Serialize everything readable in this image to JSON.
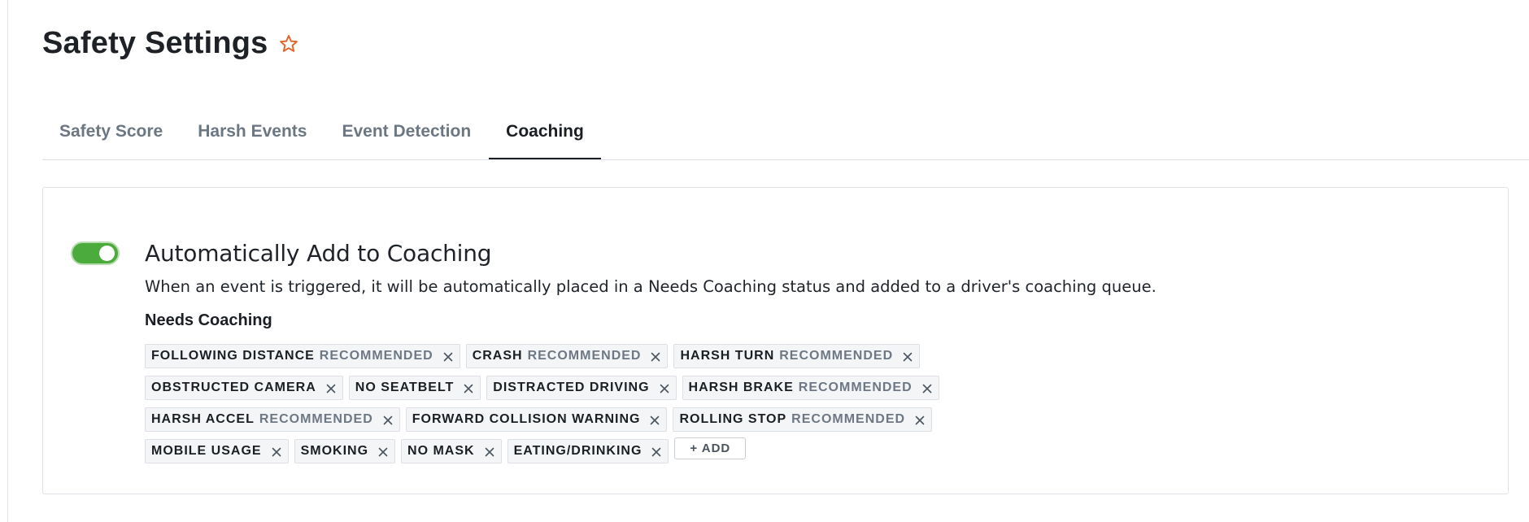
{
  "page": {
    "title": "Safety Settings",
    "favorite_icon": "star-outline-icon",
    "accent": "#e0662b"
  },
  "tabs": [
    {
      "label": "Safety Score",
      "active": false
    },
    {
      "label": "Harsh Events",
      "active": false
    },
    {
      "label": "Event Detection",
      "active": false
    },
    {
      "label": "Coaching",
      "active": true
    }
  ],
  "coaching": {
    "toggle": {
      "on": true,
      "color": "#4bab3d"
    },
    "title": "Automatically Add to Coaching",
    "description": "When an event is triggered, it will be automatically placed in a Needs Coaching status and added to a driver's coaching queue.",
    "needs_coaching_label": "Needs Coaching",
    "recommended_label": "RECOMMENDED",
    "tag_rows": [
      [
        {
          "name": "FOLLOWING DISTANCE",
          "recommended": true
        },
        {
          "name": "CRASH",
          "recommended": true
        },
        {
          "name": "HARSH TURN",
          "recommended": true
        }
      ],
      [
        {
          "name": "OBSTRUCTED CAMERA",
          "recommended": false
        },
        {
          "name": "NO SEATBELT",
          "recommended": false
        },
        {
          "name": "DISTRACTED DRIVING",
          "recommended": false
        },
        {
          "name": "HARSH BRAKE",
          "recommended": true
        }
      ],
      [
        {
          "name": "HARSH ACCEL",
          "recommended": true
        },
        {
          "name": "FORWARD COLLISION WARNING",
          "recommended": false
        },
        {
          "name": "ROLLING STOP",
          "recommended": true
        }
      ],
      [
        {
          "name": "MOBILE USAGE",
          "recommended": false
        },
        {
          "name": "SMOKING",
          "recommended": false
        },
        {
          "name": "NO MASK",
          "recommended": false
        },
        {
          "name": "EATING/DRINKING",
          "recommended": false
        }
      ]
    ],
    "add_button_label": "+ ADD"
  }
}
